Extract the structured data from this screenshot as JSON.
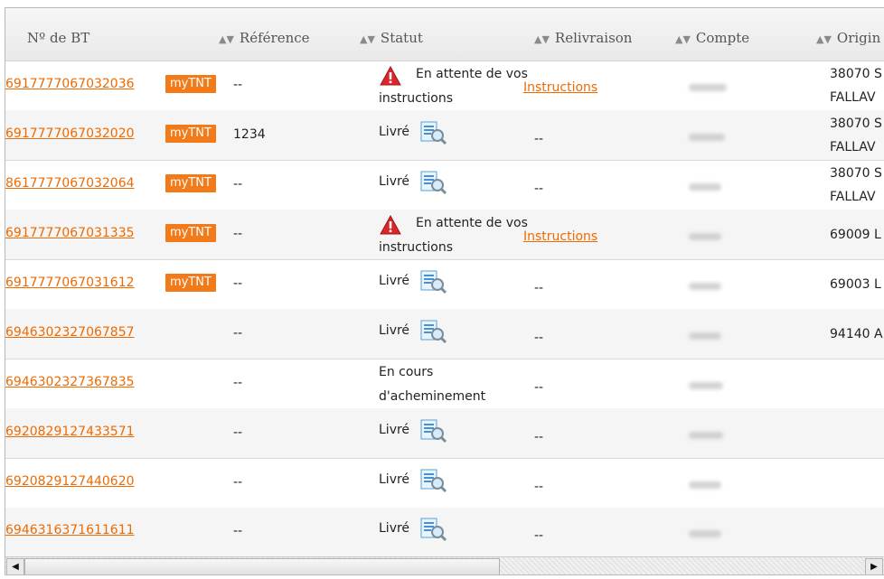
{
  "columns": {
    "bt": "Nº de BT",
    "reference": "Référence",
    "statut": "Statut",
    "relivraison": "Relivraison",
    "compte": "Compte",
    "origine": "Origin"
  },
  "icons": {
    "sort": "sort-arrows-icon",
    "warning": "warning-triangle-icon",
    "details": "document-magnifier-icon",
    "scroll_left": "scroll-left-arrow-icon",
    "scroll_right": "scroll-right-arrow-icon"
  },
  "colors": {
    "link": "#ef6a00",
    "badge": "#f27a18",
    "warning": "#d9262a"
  },
  "rows": [
    {
      "bt": "6917777067032036",
      "badge": "myTNT",
      "ref": "--",
      "statut_l1": "En attente de vos",
      "statut_l2": "instructions",
      "warn": true,
      "relivraison": "Instructions",
      "relink": true,
      "origin_l1": "38070 S",
      "origin_l2": "FALLAV"
    },
    {
      "bt": "6917777067032020",
      "badge": "myTNT",
      "ref": "1234",
      "statut_l1": "Livré",
      "statut_l2": "",
      "doc": true,
      "relivraison": "--",
      "origin_l1": "38070 S",
      "origin_l2": "FALLAV"
    },
    {
      "bt": "8617777067032064",
      "badge": "myTNT",
      "ref": "--",
      "statut_l1": "Livré",
      "statut_l2": "",
      "doc": true,
      "relivraison": "--",
      "origin_l1": "38070 S",
      "origin_l2": "FALLAV"
    },
    {
      "bt": "6917777067031335",
      "badge": "myTNT",
      "ref": "--",
      "statut_l1": "En attente de vos",
      "statut_l2": "instructions",
      "warn": true,
      "relivraison": "Instructions",
      "relink": true,
      "origin_l1": "69009 L",
      "origin_l2": ""
    },
    {
      "bt": "6917777067031612",
      "badge": "myTNT",
      "ref": "--",
      "statut_l1": "Livré",
      "statut_l2": "",
      "doc": true,
      "relivraison": "--",
      "origin_l1": "69003 L",
      "origin_l2": ""
    },
    {
      "bt": "6946302327067857",
      "badge": "",
      "ref": "--",
      "statut_l1": "Livré",
      "statut_l2": "",
      "doc": true,
      "relivraison": "--",
      "origin_l1": "94140 A",
      "origin_l2": ""
    },
    {
      "bt": "6946302327367835",
      "badge": "",
      "ref": "--",
      "statut_l1": "En cours",
      "statut_l2": "d'acheminement",
      "relivraison": "--",
      "origin_l1": "",
      "origin_l2": ""
    },
    {
      "bt": "6920829127433571",
      "badge": "",
      "ref": "--",
      "statut_l1": "Livré",
      "statut_l2": "",
      "doc": true,
      "relivraison": "--",
      "origin_l1": "",
      "origin_l2": ""
    },
    {
      "bt": "6920829127440620",
      "badge": "",
      "ref": "--",
      "statut_l1": "Livré",
      "statut_l2": "",
      "doc": true,
      "relivraison": "--",
      "origin_l1": "",
      "origin_l2": ""
    },
    {
      "bt": "6946316371611611",
      "badge": "",
      "ref": "--",
      "statut_l1": "Livré",
      "statut_l2": "",
      "doc": true,
      "relivraison": "--",
      "origin_l1": "",
      "origin_l2": ""
    }
  ]
}
